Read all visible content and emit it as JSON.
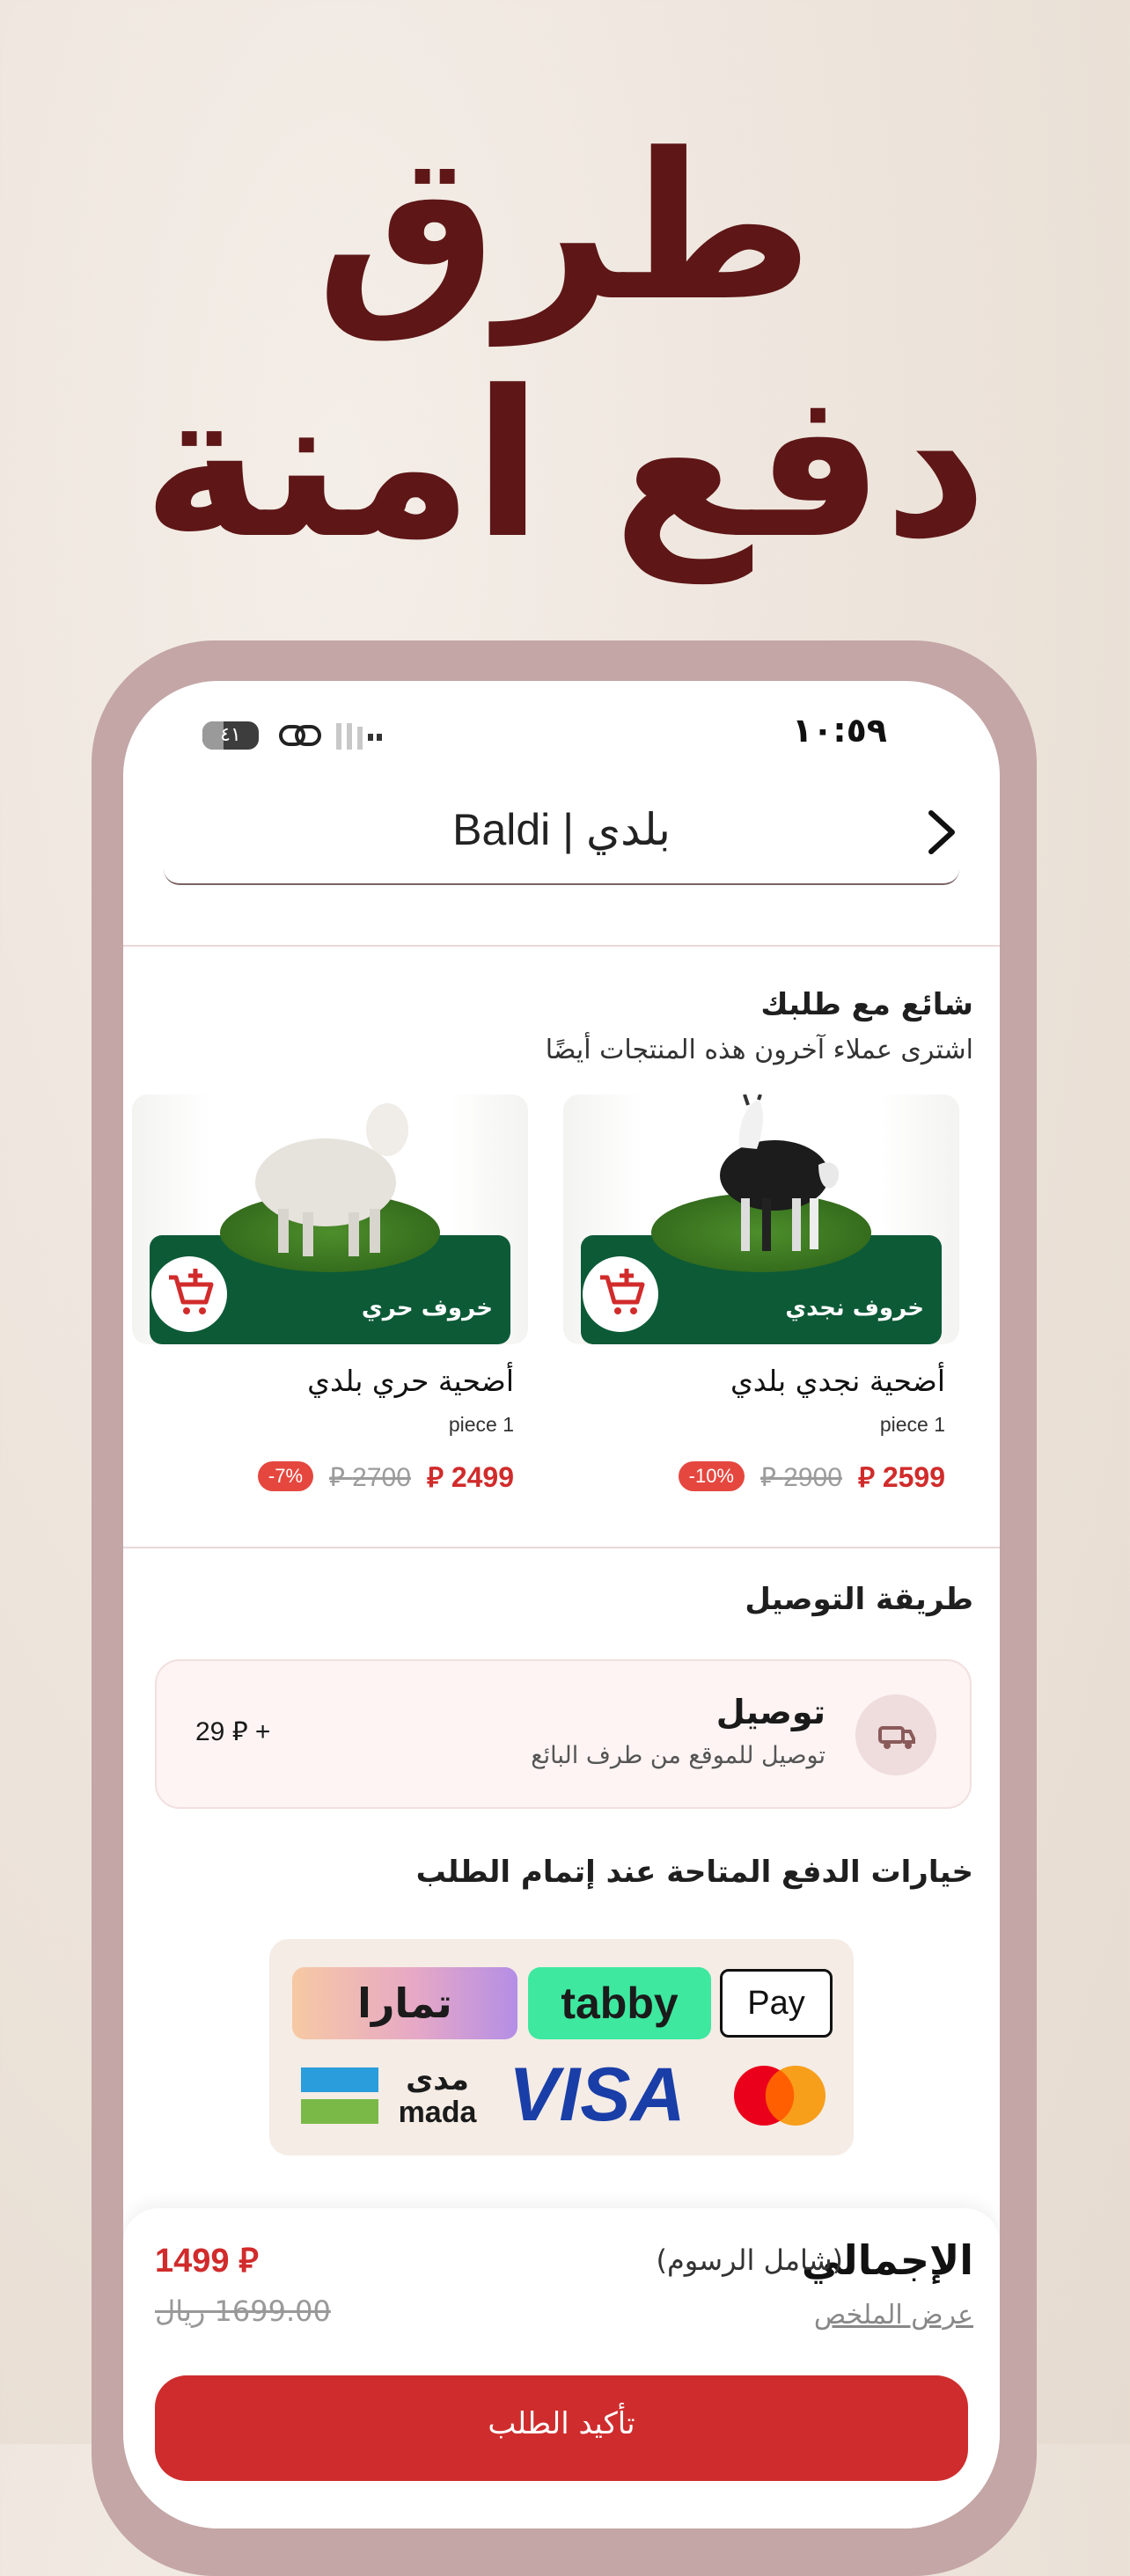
{
  "promo": {
    "headline_line1": "طرق",
    "headline_line2": "دفع امنة"
  },
  "statusbar": {
    "time": "١٠:٥٩",
    "battery": "٤١"
  },
  "header": {
    "title": "Baldi | بلدي"
  },
  "popular": {
    "title": "شائع مع طلبك",
    "subtitle": "اشترى عملاء آخرون هذه المنتجات أيضًا",
    "products": [
      {
        "banner": "خروف نجدي",
        "name": "أضحية نجدي بلدي",
        "qty": "piece 1",
        "price": "2599",
        "old_price": "2900",
        "discount": "10%-"
      },
      {
        "banner": "خروف حري",
        "name": "أضحية حري بلدي",
        "qty": "piece 1",
        "price": "2499",
        "old_price": "2700",
        "discount": "7%-"
      }
    ]
  },
  "delivery": {
    "title": "طريقة التوصيل",
    "option_title": "توصيل",
    "option_sub": "توصيل للموقع من طرف البائع",
    "option_price": "29 ⃁ +"
  },
  "payments": {
    "title": "خيارات الدفع المتاحة عند إتمام الطلب",
    "tamara": "تمارا",
    "tabby": "tabby",
    "applepay": "Pay",
    "mada_ar": "مدى",
    "mada_en": "mada",
    "visa": "VISA"
  },
  "total": {
    "label": "الإجمالي",
    "note": "(شامل الرسوم)",
    "summary_link": "عرض الملخص",
    "price": "1499",
    "old_price": "1699.00 ريال",
    "confirm_label": "تأكيد الطلب"
  },
  "colors": {
    "accent_red": "#d12b2b",
    "headline": "#5e1616",
    "frame": "#c3a6a5"
  }
}
